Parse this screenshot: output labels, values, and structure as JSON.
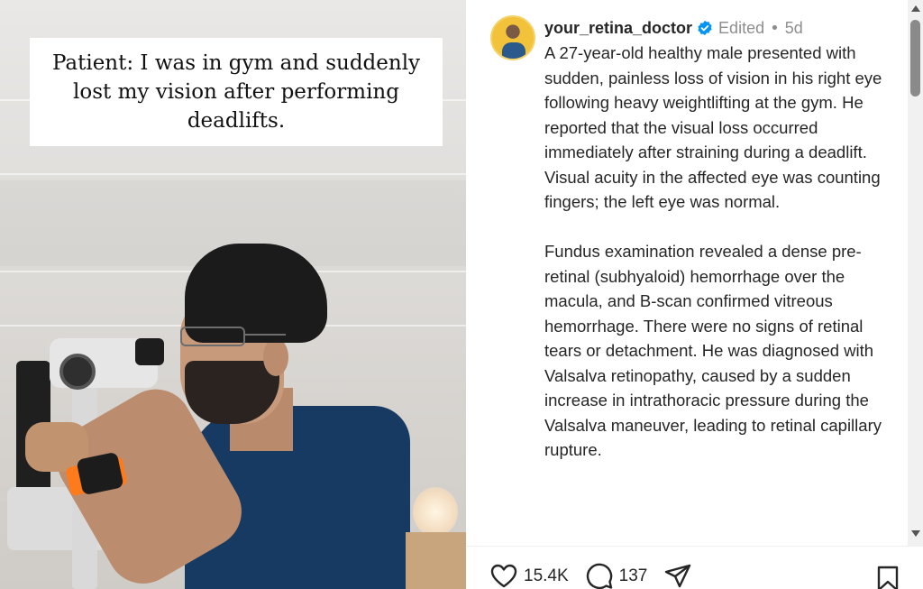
{
  "media": {
    "caption": "Patient: I was in gym and suddenly lost my vision after performing deadlifts."
  },
  "post": {
    "username": "your_retina_doctor",
    "edited_label": "Edited",
    "separator": "•",
    "age": "5d",
    "caption_paragraphs": [
      "A 27-year-old healthy male presented with sudden, painless loss of vision in his right eye following heavy weightlifting at the gym. He reported that the visual loss occurred immediately after straining during a deadlift. Visual acuity in the affected eye was counting fingers; the left eye was normal.",
      "Fundus examination revealed a dense pre-retinal (subhyaloid) hemorrhage over the macula, and B-scan confirmed vitreous hemorrhage. There were no signs of retinal tears or detachment. He was diagnosed with Valsalva retinopathy, caused by a sudden increase in intrathoracic pressure during the Valsalva maneuver, leading to retinal capillary rupture."
    ]
  },
  "actions": {
    "likes": "15.4K",
    "comments": "137",
    "icons": [
      "heart-icon",
      "comment-icon",
      "share-icon",
      "bookmark-icon"
    ]
  },
  "colors": {
    "verified": "#0095f6",
    "text": "#262626",
    "muted": "#8e8e8e"
  }
}
